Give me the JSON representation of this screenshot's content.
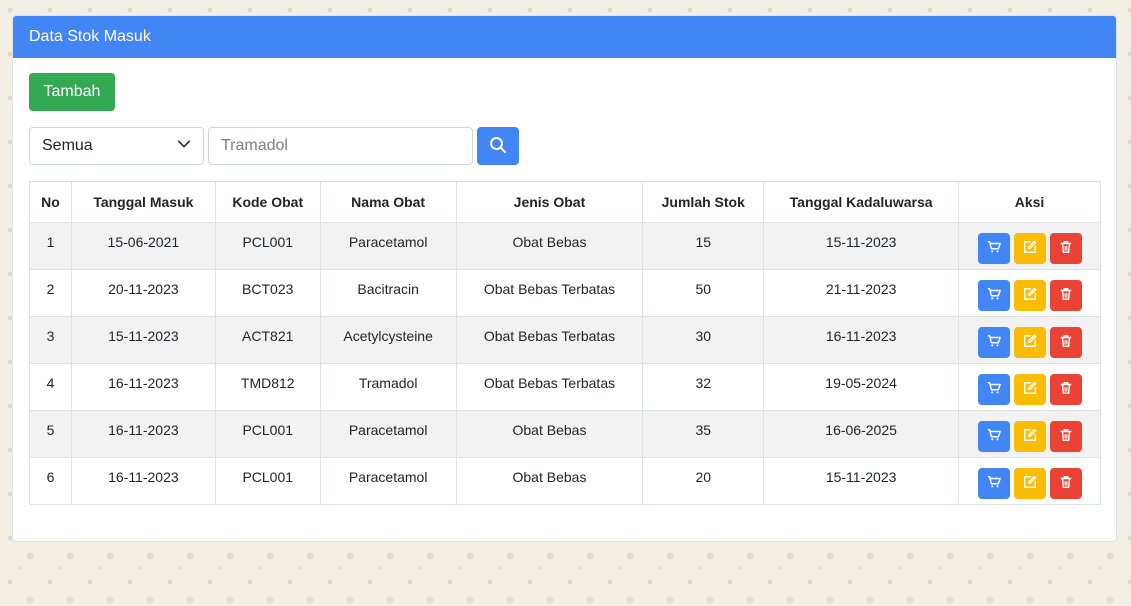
{
  "card": {
    "title": "Data Stok Masuk"
  },
  "toolbar": {
    "add_label": "Tambah"
  },
  "filter": {
    "selected": "Semua",
    "search_placeholder": "Tramadol"
  },
  "table": {
    "headers": [
      "No",
      "Tanggal Masuk",
      "Kode Obat",
      "Nama Obat",
      "Jenis Obat",
      "Jumlah Stok",
      "Tanggal Kadaluwarsa",
      "Aksi"
    ],
    "rows": [
      [
        "1",
        "15-06-2021",
        "PCL001",
        "Paracetamol",
        "Obat Bebas",
        "15",
        "15-11-2023"
      ],
      [
        "2",
        "20-11-2023",
        "BCT023",
        "Bacitracin",
        "Obat Bebas Terbatas",
        "50",
        "21-11-2023"
      ],
      [
        "3",
        "15-11-2023",
        "ACT821",
        "Acetylcysteine",
        "Obat Bebas Terbatas",
        "30",
        "16-11-2023"
      ],
      [
        "4",
        "16-11-2023",
        "TMD812",
        "Tramadol",
        "Obat Bebas Terbatas",
        "32",
        "19-05-2024"
      ],
      [
        "5",
        "16-11-2023",
        "PCL001",
        "Paracetamol",
        "Obat Bebas",
        "35",
        "16-06-2025"
      ],
      [
        "6",
        "16-11-2023",
        "PCL001",
        "Paracetamol",
        "Obat Bebas",
        "20",
        "15-11-2023"
      ]
    ]
  },
  "icons": {
    "search": "search-icon",
    "select": "chevron-down-icon",
    "cart": "cart-icon",
    "edit": "edit-icon",
    "delete": "trash-icon"
  },
  "colors": {
    "primary": "#4285f4",
    "success": "#34a853",
    "warning": "#fbbc05",
    "danger": "#ea4335"
  }
}
